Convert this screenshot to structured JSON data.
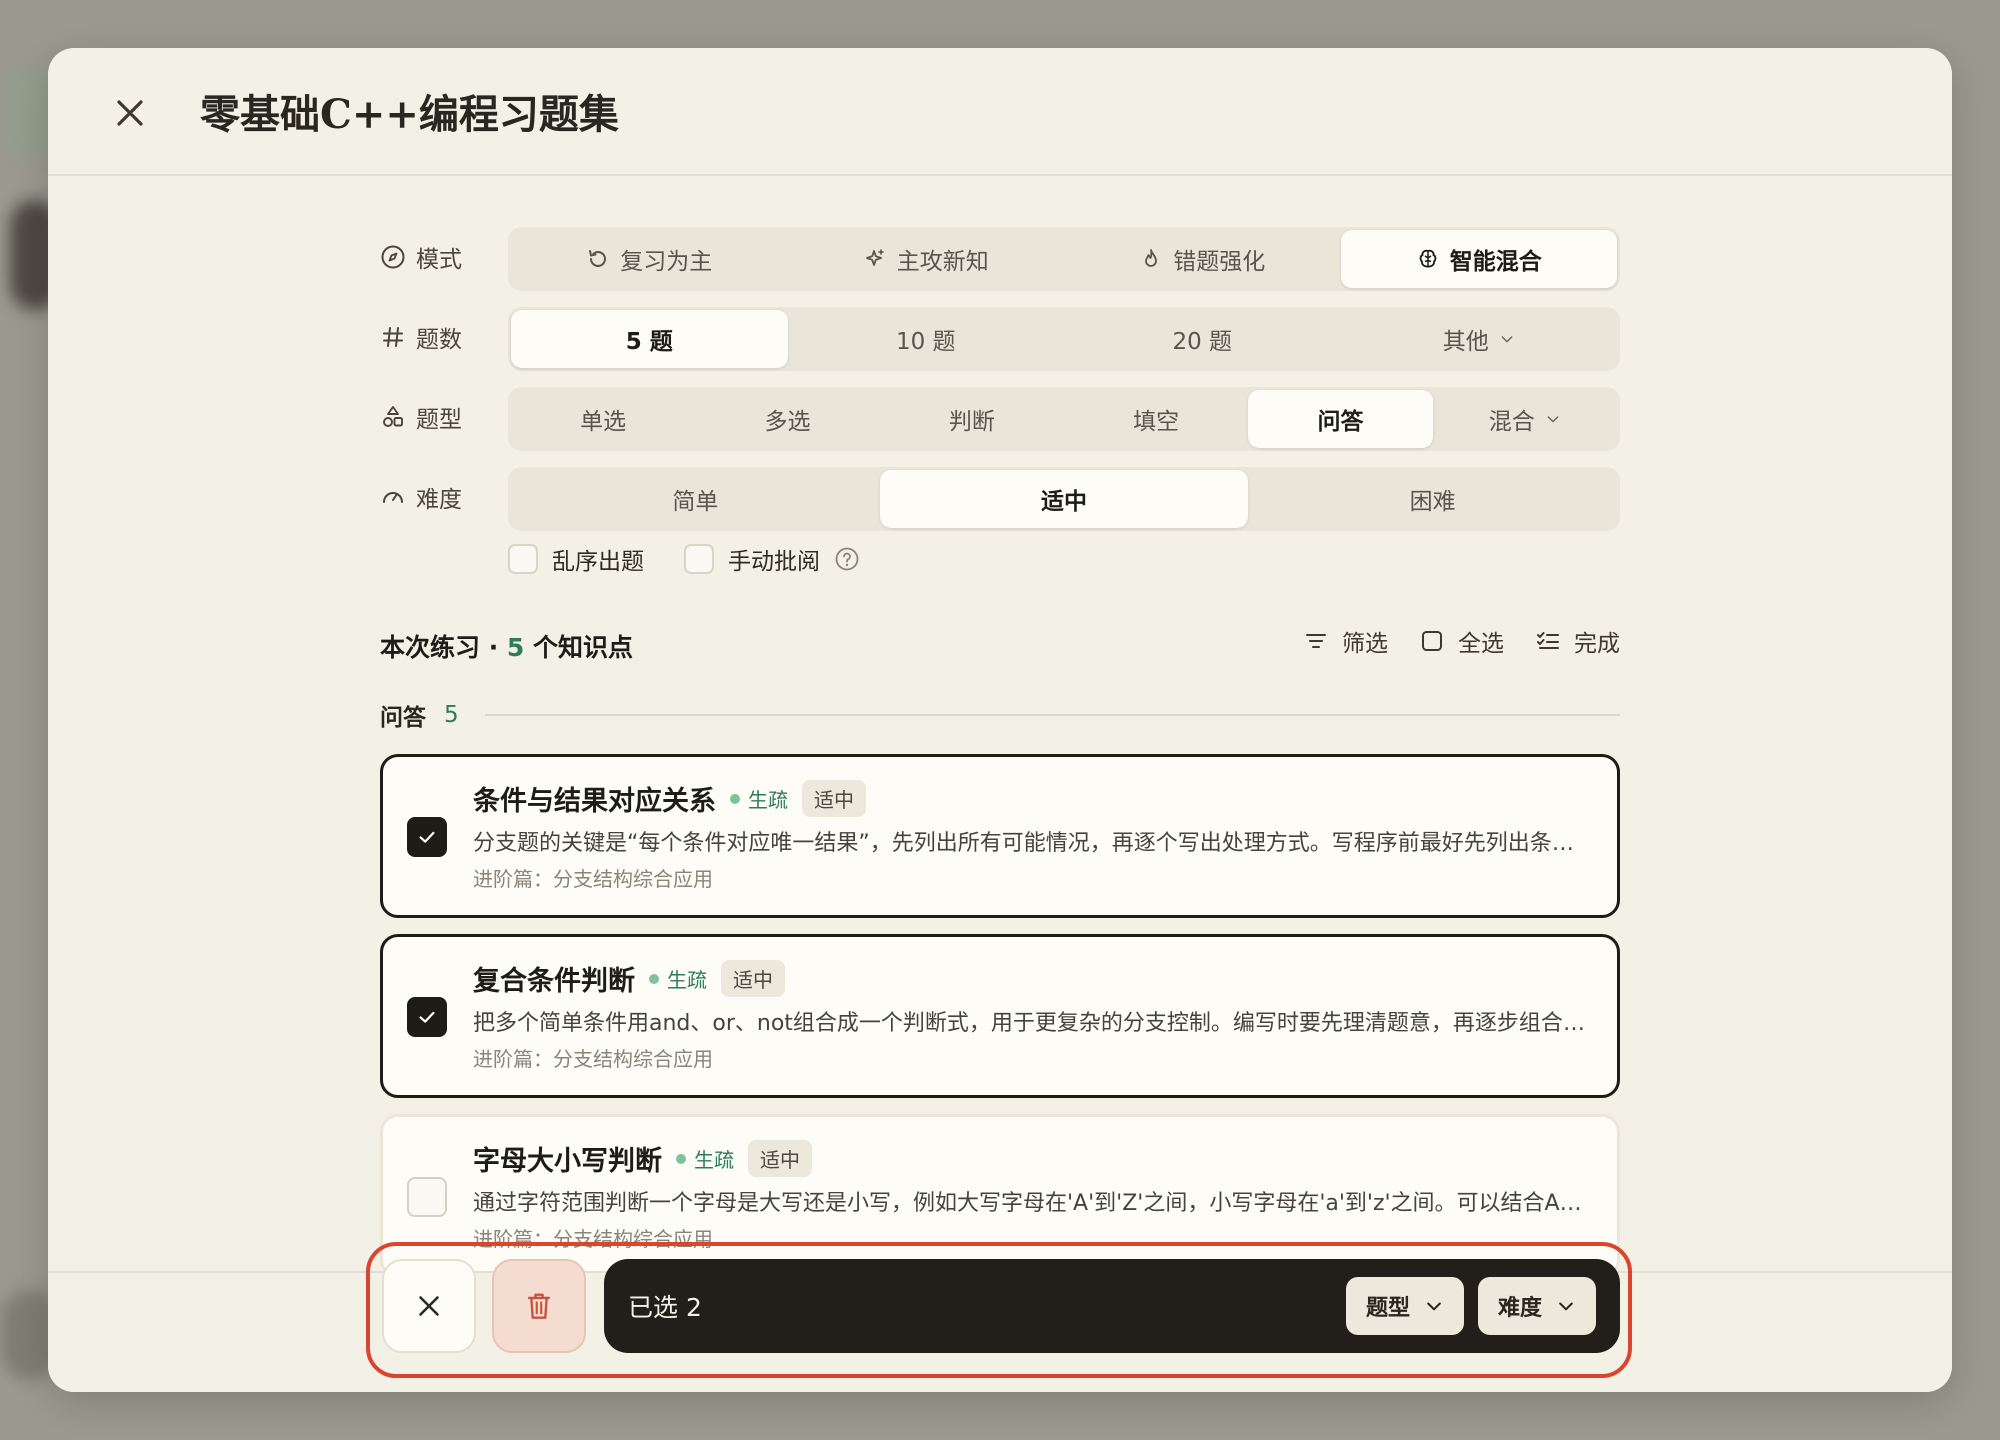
{
  "title": "零基础C++编程习题集",
  "labels": {
    "mode": "模式",
    "count": "题数",
    "type": "题型",
    "difficulty": "难度"
  },
  "mode_options": [
    {
      "label": "复习为主",
      "icon": "rotate-icon"
    },
    {
      "label": "主攻新知",
      "icon": "sparkle-icon"
    },
    {
      "label": "错题强化",
      "icon": "flame-icon"
    },
    {
      "label": "智能混合",
      "icon": "brain-icon"
    }
  ],
  "mode_selected": "智能混合",
  "count_options": [
    "5 题",
    "10 题",
    "20 题",
    "其他"
  ],
  "count_selected": "5 题",
  "type_options": [
    "单选",
    "多选",
    "判断",
    "填空",
    "问答",
    "混合"
  ],
  "type_selected": "问答",
  "difficulty_options": [
    "简单",
    "适中",
    "困难"
  ],
  "difficulty_selected": "适中",
  "toggles": {
    "shuffle": "乱序出题",
    "manual_grade": "手动批阅"
  },
  "summary": {
    "prefix": "本次练习 · ",
    "count": "5",
    "suffix": " 个知识点"
  },
  "tools": {
    "filter": "筛选",
    "select_all": "全选",
    "done": "完成"
  },
  "group": {
    "name": "问答",
    "count": "5"
  },
  "cards": [
    {
      "title": "条件与结果对应关系",
      "mastery": "生疏",
      "difficulty": "适中",
      "desc": "分支题的关键是“每个条件对应唯一结果”，先列出所有可能情况，再逐个写出处理方式。写程序前最好先列出条件与结果的对应表，避免遗漏",
      "path": "进阶篇：分支结构综合应用",
      "checked": true
    },
    {
      "title": "复合条件判断",
      "mastery": "生疏",
      "difficulty": "适中",
      "desc": "把多个简单条件用and、or、not组合成一个判断式，用于更复杂的分支控制。编写时要先理清题意，再逐步组合条件",
      "path": "进阶篇：分支结构综合应用",
      "checked": true
    },
    {
      "title": "字母大小写判断",
      "mastery": "生疏",
      "difficulty": "适中",
      "desc": "通过字符范围判断一个字母是大写还是小写，例如大写字母在'A'到'Z'之间，小写字母在'a'到'z'之间。可以结合ASCII码理解",
      "path": "进阶篇：分支结构综合应用",
      "checked": false
    }
  ],
  "action_bar": {
    "selected_text": "已选 2",
    "type_btn": "题型",
    "difficulty_btn": "难度"
  },
  "colors": {
    "accent_green": "#2e7d58",
    "dark": "#221f1a",
    "highlight": "#d9452f",
    "background": "#f3f0e5"
  }
}
